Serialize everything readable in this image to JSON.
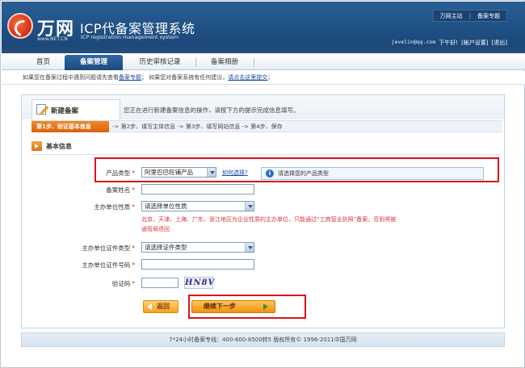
{
  "header": {
    "logo_text": "万网",
    "logo_url": "www.NET.CN",
    "title": "ICP代备案管理系统",
    "subtitle": "ICP registration management system",
    "top_links": [
      "万网主站",
      "备案专题"
    ],
    "user_email": "jevelin@qq.com",
    "greeting": "下午好!",
    "account_settings": "[帐户设置]",
    "logout": "[退出]"
  },
  "nav": {
    "items": [
      {
        "label": "首页",
        "active": false
      },
      {
        "label": "备案管理",
        "active": true
      },
      {
        "label": "历史审核记录",
        "active": false
      },
      {
        "label": "备案相册",
        "active": false
      }
    ]
  },
  "notice": {
    "prefix": "如果您在备案过程中遇到问题请先查看",
    "link1": "备案专题",
    "middle": "；  如果您对备案系统有任何建议，",
    "link2": "请点击这里提交",
    "suffix": "；"
  },
  "panel": {
    "tab_label": "新建备案",
    "description": "您正在进行新建备案信息的操作，请按下方的提示完成信息填写。"
  },
  "steps": {
    "active": "第1步、验证基本信息",
    "rest": "-> 第2步、填写主体信息 -> 第3步、填写网站信息 -> 第4步、保存"
  },
  "section": {
    "title": "基本信息"
  },
  "form": {
    "product_type": {
      "label": "产品类型",
      "value": "阿里巴巴旺铺产品",
      "help_link": "如何选择?",
      "tip": "请选择您的产品类型"
    },
    "record_name": {
      "label": "备案姓名"
    },
    "org_nature": {
      "label": "主办单位性质",
      "value": "请选择单位性质",
      "note_line1": "北京、天津、上海、广东、浙江地区为企业性质的主办单位，只能通过“工商营业执照”备案，否则将被",
      "note_line2": "通管局退回"
    },
    "cert_type": {
      "label": "主办单位证件类型",
      "value": "请选择证件类型"
    },
    "cert_number": {
      "label": "主办单位证件号码"
    },
    "captcha": {
      "label": "验证码",
      "image_text": "HN8V"
    },
    "back_button": "返回",
    "next_button": "继续下一步"
  },
  "footer": {
    "text": "7*24小时备案专线：400-600-8500转5  版权所有© 1996-2011中国万网"
  },
  "colors": {
    "header_blue": "#1f4f83",
    "accent_orange": "#f08a2a",
    "highlight_red": "#d9141a"
  }
}
